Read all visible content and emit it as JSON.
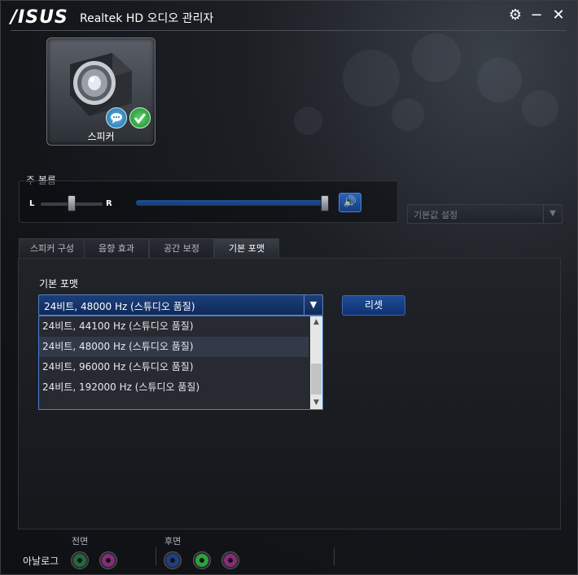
{
  "window": {
    "logo": "/ISUS",
    "title": "Realtek HD 오디오 관리자",
    "buttons": {
      "settings": "⚙",
      "minimize": "−",
      "close": "✕"
    }
  },
  "device": {
    "label": "스피커"
  },
  "volume": {
    "label": "주 볼륨",
    "left": "L",
    "right": "R",
    "balance_level": 0.5,
    "volume_level": 1.0
  },
  "default_setting": {
    "label": "기본값 설정"
  },
  "tabs": [
    {
      "label": "스피커 구성",
      "active": false
    },
    {
      "label": "음향 효과",
      "active": false
    },
    {
      "label": "공간 보정",
      "active": false
    },
    {
      "label": "기본 포맷",
      "active": true
    }
  ],
  "format": {
    "label": "기본 포맷",
    "selected": "24비트, 48000 Hz (스튜디오 품질)",
    "reset": "리셋",
    "options": [
      "24비트, 44100 Hz (스튜디오 품질)",
      "24비트, 48000 Hz (스튜디오 품질)",
      "24비트, 96000 Hz (스튜디오 품질)",
      "24비트, 192000 Hz (스튜디오 품질)"
    ],
    "highlighted_index": 1
  },
  "footer": {
    "analog": "아날로그",
    "front": "전면",
    "rear": "후면",
    "front_jack_colors": [
      "#1f6b3a",
      "#8a2a7a"
    ],
    "rear_jack_colors": [
      "#1f3f8a",
      "#2aa53a",
      "#8a2a7a"
    ]
  },
  "colors": {
    "accent": "#1c3f7a",
    "selection_border": "#4a7fd0"
  }
}
